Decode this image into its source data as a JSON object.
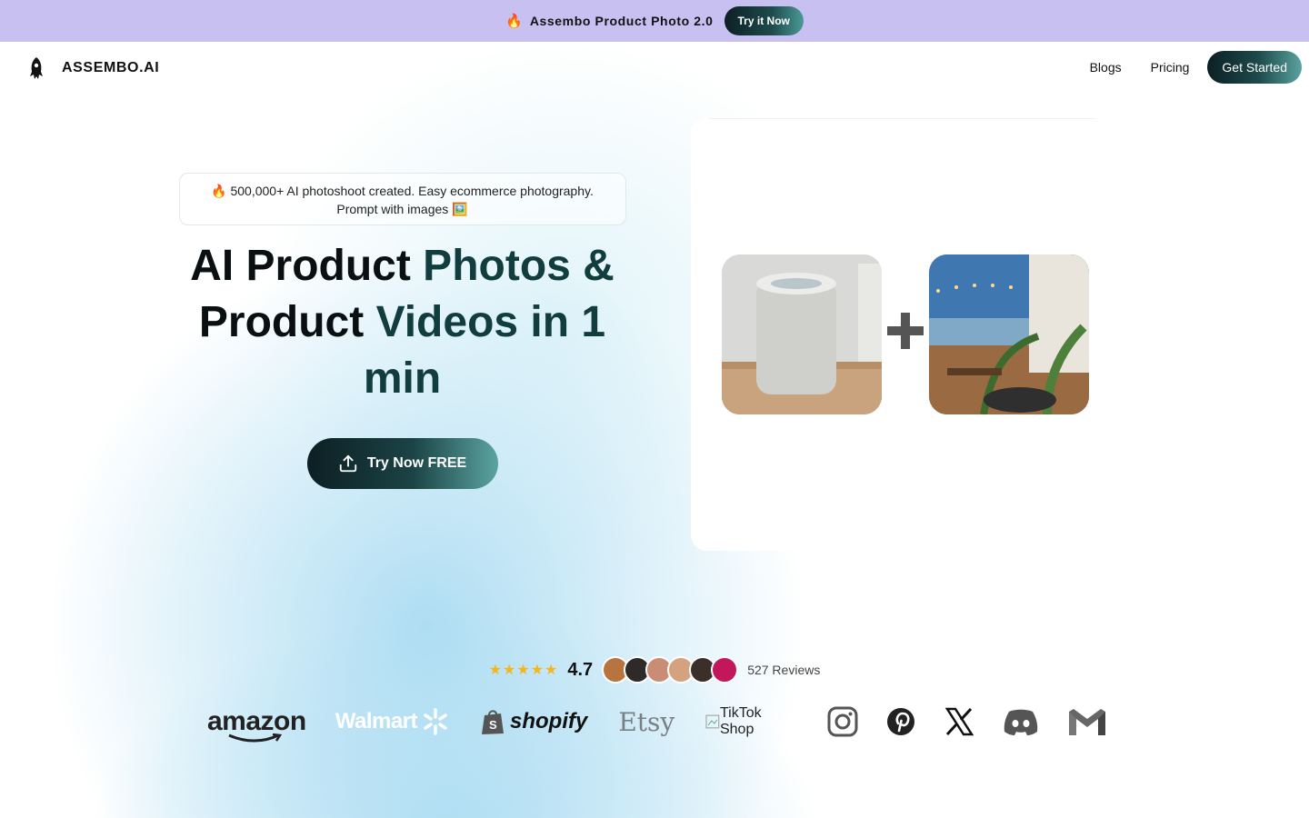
{
  "announcement": {
    "title": "Assembo Product Photo 2.0",
    "button_label": "Try it Now"
  },
  "nav": {
    "brand": "ASSEMBO.AI",
    "links": [
      "Blogs",
      "Pricing"
    ],
    "cta_label": "Get Started"
  },
  "hero": {
    "pill_line1": "500,000+ AI photoshoot created. Easy ecommerce photography.",
    "pill_line2": "Prompt with images",
    "headline_part1": "AI Product ",
    "headline_part2": "Photos & ",
    "headline_part3": "Product ",
    "headline_part4": "Videos in 1 ",
    "headline_part5": "min",
    "cta_label": "Try Now FREE"
  },
  "social_proof": {
    "stars": "★★★★★",
    "rating": "4.7",
    "reviews": "527 Reviews",
    "avatar_colors": [
      "#b8743f",
      "#2e2a2a",
      "#c98c74",
      "#d4a27e",
      "#3b2f2a",
      "#c2185b"
    ]
  },
  "logos": {
    "amazon": "amazon",
    "walmart": "Walmart",
    "shopify": "shopify",
    "etsy": "Etsy",
    "tiktok": "TikTok Shop",
    "icons": [
      "instagram-icon",
      "pinterest-icon",
      "x-icon",
      "discord-icon",
      "gmail-icon"
    ]
  },
  "colors": {
    "announcement_bg": "#c9c0f2",
    "accent_dark": "#0c1f24",
    "accent_teal": "#5aa3a0",
    "star": "#f5b51d"
  }
}
